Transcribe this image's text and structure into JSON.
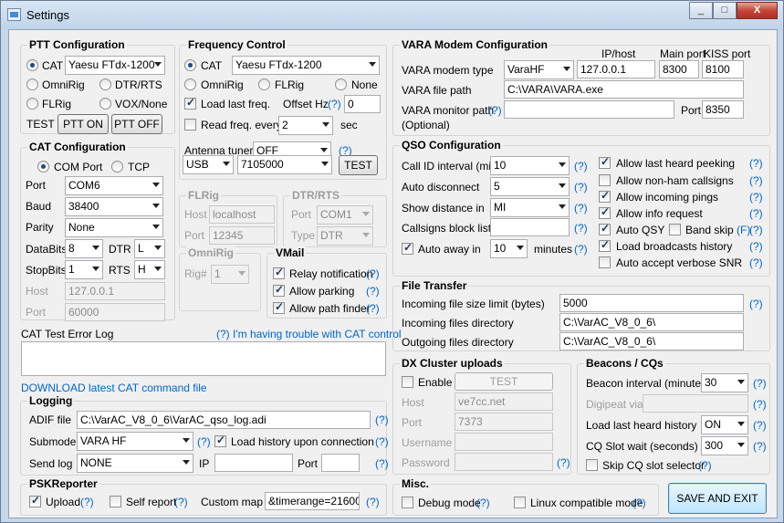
{
  "window": {
    "title": "Settings",
    "min": "_",
    "max": "□",
    "close": "X"
  },
  "ptt": {
    "title": "PTT Configuration",
    "cat": "CAT",
    "rig": "Yaesu FTdx-1200",
    "omnirig": "OmniRig",
    "dtr_rts": "DTR/RTS",
    "flrig": "FLRig",
    "vox": "VOX/None",
    "test_label": "TEST",
    "ptt_on": "PTT ON",
    "ptt_off": "PTT OFF"
  },
  "catcfg": {
    "title": "CAT Configuration",
    "com_port": "COM Port",
    "tcp": "TCP",
    "port_label": "Port",
    "port": "COM6",
    "baud_label": "Baud",
    "baud": "38400",
    "parity_label": "Parity",
    "parity": "None",
    "databits_label": "DataBits",
    "databits": "8",
    "dtr_label": "DTR",
    "dtr": "L",
    "stopbits_label": "StopBits",
    "stopbits": "1",
    "rts_label": "RTS",
    "rts": "H",
    "host_label": "Host",
    "host": "127.0.0.1",
    "tport_label": "Port",
    "tport": "60000"
  },
  "freq": {
    "title": "Frequency Control",
    "cat": "CAT",
    "rig": "Yaesu FTdx-1200",
    "omnirig": "OmniRig",
    "flrig": "FLRig",
    "none": "None",
    "load_last": "Load last freq.",
    "offset_label": "Offset Hz",
    "offset_help": "(?)",
    "offset": "0",
    "read_every": "Read freq. every",
    "read_val": "2",
    "sec": "sec",
    "antenna_label": "Antenna tuner",
    "antenna": "OFF",
    "antenna_help": "(?)",
    "mode": "USB",
    "frequency": "7105000",
    "test": "TEST"
  },
  "flrig": {
    "title": "FLRig",
    "host_label": "Host",
    "host": "localhost",
    "port_label": "Port",
    "port": "12345"
  },
  "dtrrts": {
    "title": "DTR/RTS",
    "port_label": "Port",
    "port": "COM1",
    "type_label": "Type",
    "type": "DTR"
  },
  "omnirig": {
    "title": "OmniRig",
    "rig_label": "Rig#",
    "rig": "1"
  },
  "vmail": {
    "title": "VMail",
    "relay": "Relay notification",
    "parking": "Allow parking",
    "pathfinder": "Allow path finder",
    "help": "(?)"
  },
  "caterr": {
    "title": "CAT Test Error Log",
    "trouble": "(?) I'm having trouble with CAT control",
    "download": "DOWNLOAD latest CAT command file"
  },
  "logging": {
    "title": "Logging",
    "adif_label": "ADIF file",
    "adif": "C:\\VarAC_V8_0_6\\VarAC_qso_log.adi",
    "help": "(?)",
    "submode_label": "Submode",
    "submode": "VARA HF",
    "load_history": "Load history upon connection",
    "sendlog_label": "Send log",
    "sendlog": "NONE",
    "ip_label": "IP",
    "port_label": "Port"
  },
  "psk": {
    "title": "PSKReporter",
    "upload": "Upload",
    "self_report": "Self report",
    "custom_map_label": "Custom map",
    "custom_map": "&timerange=21600&s",
    "help": "(?)"
  },
  "vara": {
    "title": "VARA Modem Configuration",
    "ip_header": "IP/host",
    "mainport_header": "Main port",
    "kissport_header": "KISS port",
    "modem_type_label": "VARA modem type",
    "modem_type": "VaraHF",
    "ip": "127.0.0.1",
    "main_port": "8300",
    "kiss_port": "8100",
    "file_path_label": "VARA file path",
    "file_path": "C:\\VARA\\VARA.exe",
    "monitor_label": "VARA monitor path",
    "optional": "(Optional)",
    "monitor_help": "(?)",
    "monitor_port_label": "Port",
    "monitor_port": "8350"
  },
  "qso": {
    "title": "QSO Configuration",
    "callid_label": "Call ID interval (min)",
    "callid": "10",
    "autodisc_label": "Auto disconnect",
    "autodisc": "5",
    "distance_label": "Show distance in",
    "distance": "MI",
    "block_label": "Callsigns block list",
    "autoaway": "Auto away in",
    "autoaway_val": "10",
    "minutes": "minutes",
    "help": "(?)",
    "allow_peeking": "Allow last heard peeking",
    "allow_nonham": "Allow non-ham callsigns",
    "allow_pings": "Allow incoming pings",
    "allow_info": "Allow info request",
    "auto_qsy": "Auto QSY",
    "band_skip": "Band skip",
    "fhelp": "(F)",
    "load_broadcasts": "Load broadcasts history",
    "auto_accept": "Auto accept verbose SNR"
  },
  "transfer": {
    "title": "File Transfer",
    "limit_label": "Incoming file size limit (bytes)",
    "limit": "5000",
    "in_dir_label": "Incoming files directory",
    "in_dir": "C:\\VarAC_V8_0_6\\",
    "out_dir_label": "Outgoing files directory",
    "out_dir": "C:\\VarAC_V8_0_6\\",
    "help": "(?)"
  },
  "dx": {
    "title": "DX Cluster uploads",
    "enable": "Enable",
    "test": "TEST",
    "host_label": "Host",
    "host": "ve7cc.net",
    "port_label": "Port",
    "port": "7373",
    "user_label": "Username",
    "pass_label": "Password",
    "help": "(?)"
  },
  "beacons": {
    "title": "Beacons / CQs",
    "interval_label": "Beacon interval (minutes)",
    "interval": "30",
    "digi_label": "Digipeat via",
    "last_heard_label": "Load last heard history",
    "last_heard": "ON",
    "cq_wait_label": "CQ Slot wait (seconds)",
    "cq_wait": "300",
    "skip_cq": "Skip CQ slot selector",
    "help": "(?)"
  },
  "misc": {
    "title": "Misc.",
    "debug": "Debug mode",
    "linux": "Linux compatible mode",
    "help": "(?)"
  },
  "save_exit": "SAVE AND EXIT"
}
